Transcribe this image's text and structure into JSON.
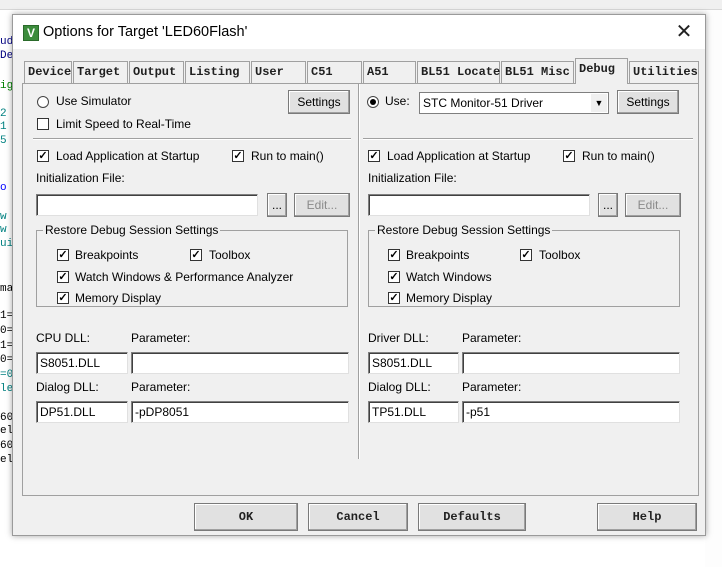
{
  "background": {
    "code_lines": [
      {
        "text": "ud",
        "color": "#000080"
      },
      {
        "text": "De",
        "color": "#000080"
      },
      {
        "text": "ig",
        "color": "#008000"
      },
      {
        "text": "2",
        "color": "#008080"
      },
      {
        "text": "1",
        "color": "#008080"
      },
      {
        "text": "5",
        "color": "#008080"
      },
      {
        "text": "o",
        "color": "#0000ff"
      },
      {
        "text": "w",
        "color": "#008080"
      },
      {
        "text": "w",
        "color": "#008080"
      },
      {
        "text": "ui",
        "color": "#008080"
      },
      {
        "text": "ma",
        "color": "#000000"
      },
      {
        "text": "1=",
        "color": "#000000"
      },
      {
        "text": "0=",
        "color": "#000000"
      },
      {
        "text": "1=",
        "color": "#000000"
      },
      {
        "text": "0=",
        "color": "#000000"
      },
      {
        "text": "=0",
        "color": "#008080"
      },
      {
        "text": "le",
        "color": "#008080"
      },
      {
        "text": "60",
        "color": "#000000"
      },
      {
        "text": "el",
        "color": "#000000"
      },
      {
        "text": "60",
        "color": "#000000"
      },
      {
        "text": "el",
        "color": "#000000"
      }
    ]
  },
  "dialog": {
    "title": "Options for Target 'LED60Flash'",
    "close_glyph": "✕",
    "app_icon_glyph": "V"
  },
  "tabs": [
    {
      "label": "Device",
      "active": false
    },
    {
      "label": "Target",
      "active": false
    },
    {
      "label": "Output",
      "active": false
    },
    {
      "label": "Listing",
      "active": false
    },
    {
      "label": "User",
      "active": false
    },
    {
      "label": "C51",
      "active": false
    },
    {
      "label": "A51",
      "active": false
    },
    {
      "label": "BL51 Locate",
      "active": false
    },
    {
      "label": "BL51 Misc",
      "active": false
    },
    {
      "label": "Debug",
      "active": true
    },
    {
      "label": "Utilities",
      "active": false
    }
  ],
  "left": {
    "use_simulator": {
      "label": "Use Simulator",
      "selected": false
    },
    "settings_button": "Settings",
    "limit_speed": {
      "label": "Limit Speed to Real-Time",
      "checked": false
    },
    "load_app": {
      "label": "Load Application at Startup",
      "checked": true
    },
    "run_to_main": {
      "label": "Run to main()",
      "checked": true
    },
    "init_file_label": "Initialization File:",
    "init_file_value": "",
    "browse_button": "...",
    "edit_button": "Edit...",
    "restore_group_title": "Restore Debug Session Settings",
    "breakpoints": {
      "label": "Breakpoints",
      "checked": true
    },
    "toolbox": {
      "label": "Toolbox",
      "checked": true
    },
    "watch_windows": {
      "label": "Watch Windows & Performance Analyzer",
      "checked": true
    },
    "memory_display": {
      "label": "Memory Display",
      "checked": true
    },
    "cpu_dll_label": "CPU DLL:",
    "cpu_param_label": "Parameter:",
    "cpu_dll_value": "S8051.DLL",
    "cpu_param_value": "",
    "dialog_dll_label": "Dialog DLL:",
    "dialog_param_label": "Parameter:",
    "dialog_dll_value": "DP51.DLL",
    "dialog_param_value": "-pDP8051"
  },
  "right": {
    "use": {
      "label": "Use:",
      "selected": true
    },
    "driver_select": "STC Monitor-51 Driver",
    "settings_button": "Settings",
    "load_app": {
      "label": "Load Application at Startup",
      "checked": true
    },
    "run_to_main": {
      "label": "Run to main()",
      "checked": true
    },
    "init_file_label": "Initialization File:",
    "init_file_value": "",
    "browse_button": "...",
    "edit_button": "Edit...",
    "restore_group_title": "Restore Debug Session Settings",
    "breakpoints": {
      "label": "Breakpoints",
      "checked": true
    },
    "toolbox": {
      "label": "Toolbox",
      "checked": true
    },
    "watch_windows": {
      "label": "Watch Windows",
      "checked": true
    },
    "memory_display": {
      "label": "Memory Display",
      "checked": true
    },
    "driver_dll_label": "Driver DLL:",
    "driver_param_label": "Parameter:",
    "driver_dll_value": "S8051.DLL",
    "driver_param_value": "",
    "dialog_dll_label": "Dialog DLL:",
    "dialog_param_label": "Parameter:",
    "dialog_dll_value": "TP51.DLL",
    "dialog_param_value": "-p51"
  },
  "footer": {
    "ok": "OK",
    "cancel": "Cancel",
    "defaults": "Defaults",
    "help": "Help"
  },
  "check_glyph": "✓"
}
